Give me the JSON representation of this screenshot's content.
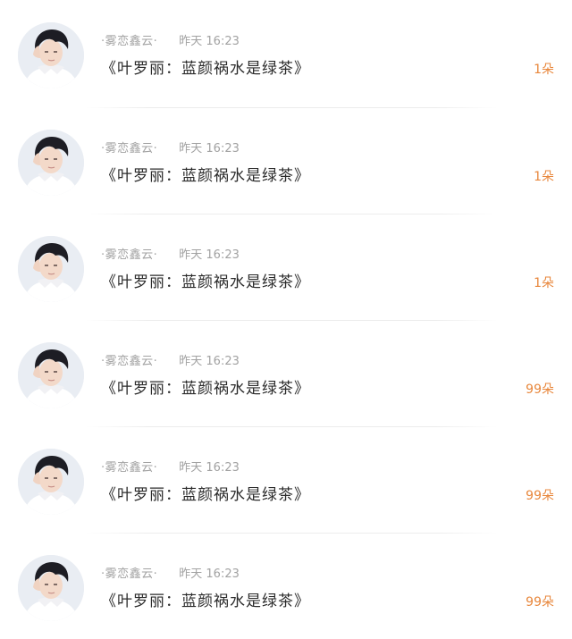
{
  "feed": {
    "items": [
      {
        "username": "·雾恋鑫云·",
        "time": "昨天 16:23",
        "message": "《叶罗丽：蓝颜祸水是绿茶》",
        "gift": "1朵"
      },
      {
        "username": "·雾恋鑫云·",
        "time": "昨天 16:23",
        "message": "《叶罗丽：蓝颜祸水是绿茶》",
        "gift": "1朵"
      },
      {
        "username": "·雾恋鑫云·",
        "time": "昨天 16:23",
        "message": "《叶罗丽：蓝颜祸水是绿茶》",
        "gift": "1朵"
      },
      {
        "username": "·雾恋鑫云·",
        "time": "昨天 16:23",
        "message": "《叶罗丽：蓝颜祸水是绿茶》",
        "gift": "99朵"
      },
      {
        "username": "·雾恋鑫云·",
        "time": "昨天 16:23",
        "message": "《叶罗丽：蓝颜祸水是绿茶》",
        "gift": "99朵"
      },
      {
        "username": "·雾恋鑫云·",
        "time": "昨天 16:23",
        "message": "《叶罗丽：蓝颜祸水是绿茶》",
        "gift": "99朵"
      }
    ]
  },
  "colors": {
    "gift_text": "#e8873c",
    "meta_text": "#a2a2a2",
    "message_text": "#2b2b2b"
  }
}
